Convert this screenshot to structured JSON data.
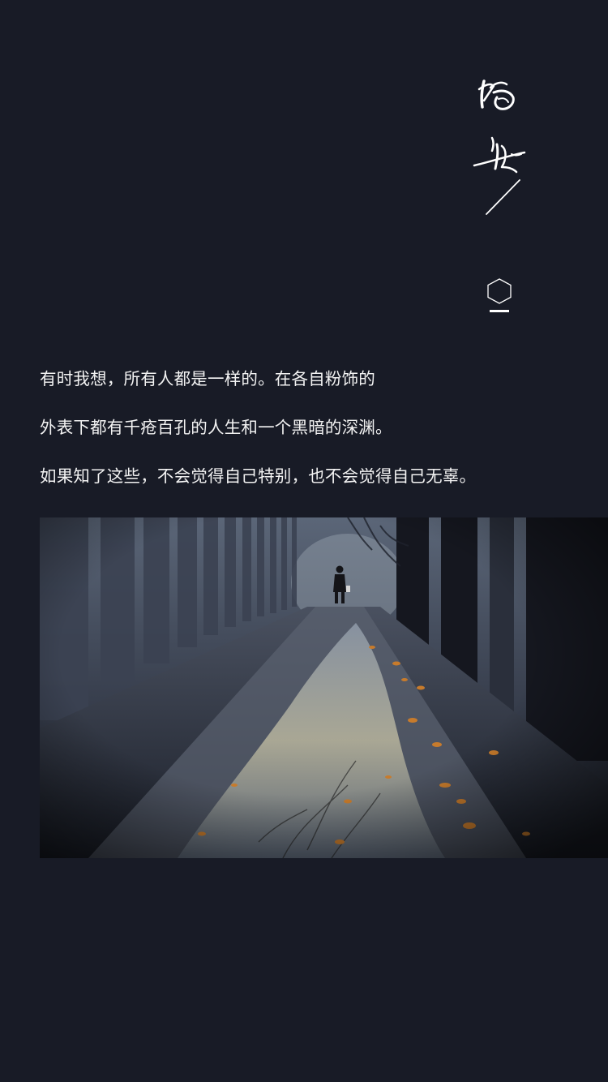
{
  "header": {
    "signature_text": "晚安",
    "signature_icon": "calligraphy-signature",
    "marker_icon": "hexagon-icon"
  },
  "poem": {
    "lines": [
      "有时我想，所有人都是一样的。在各自粉饰的",
      "外表下都有千疮百孔的人生和一个黑暗的深渊。",
      "如果知了这些，不会觉得自己特别，也不会觉得自己无辜。"
    ]
  },
  "photo": {
    "subject": "rainy-avenue-photo"
  },
  "colors": {
    "background": "#181b26",
    "text": "#f3f3f3",
    "accent": "#ffffff"
  }
}
